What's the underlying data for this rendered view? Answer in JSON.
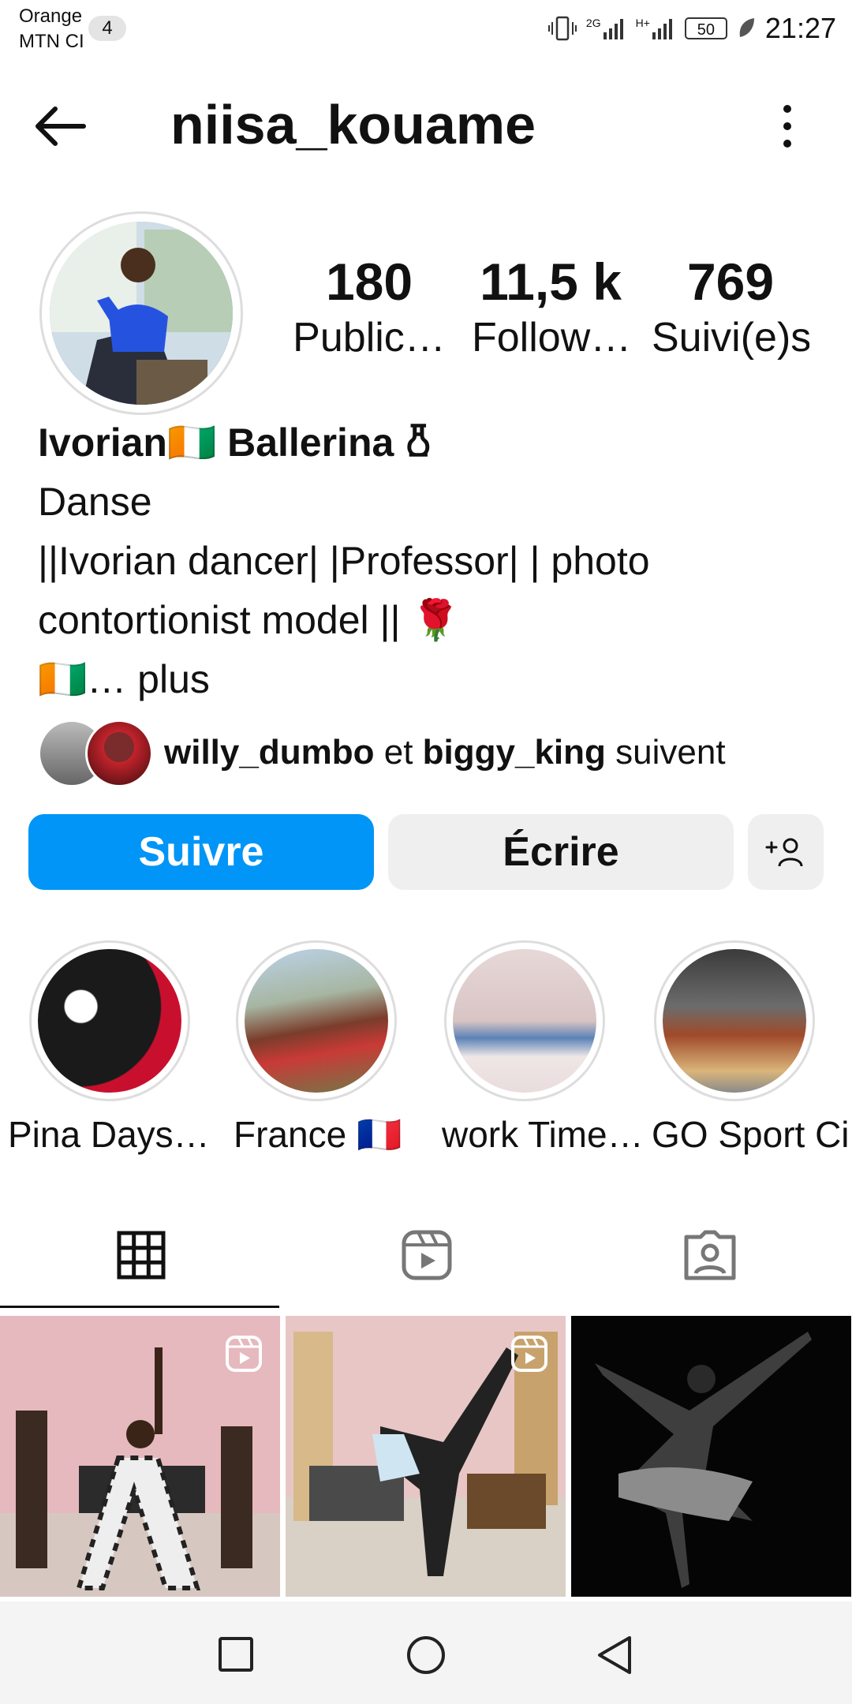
{
  "status_bar": {
    "carrier_line1": "Orange",
    "carrier_line2": "MTN CI",
    "notification_count": "4",
    "network_2g": "2G",
    "network_h": "H+",
    "battery": "50",
    "time": "21:27"
  },
  "header": {
    "username": "niisa_kouame",
    "back_icon": "arrow-left-icon",
    "more_icon": "more-vertical-icon"
  },
  "stats": [
    {
      "value": "180",
      "label": "Public…"
    },
    {
      "value": "11,5 k",
      "label": "Follow…"
    },
    {
      "value": "769",
      "label": "Suivi(e)s"
    }
  ],
  "bio": {
    "display_name": "Ivorian🇨🇮 Ballerina 𐃰",
    "category": "Danse",
    "line1": "||Ivorian dancer| |Professor| | photo",
    "line2": "contortionist model || 🌹",
    "line3": "🇨🇮… plus"
  },
  "mutual": {
    "user1": "willy_dumbo",
    "connector": "et",
    "user2": "biggy_king",
    "suffix": "suivent"
  },
  "actions": {
    "follow_label": "Suivre",
    "message_label": "Écrire",
    "add_user_icon": "add-user-icon",
    "accent_color": "#0095f6"
  },
  "highlights": [
    {
      "label": "Pina Days…"
    },
    {
      "label": "France 🇫🇷"
    },
    {
      "label": "work Time…"
    },
    {
      "label": "GO Sport Ci"
    }
  ],
  "tabs": [
    {
      "icon": "grid-icon",
      "active": true
    },
    {
      "icon": "reels-icon",
      "active": false
    },
    {
      "icon": "tagged-icon",
      "active": false
    }
  ],
  "nav": [
    "recent-apps-icon",
    "home-icon",
    "back-icon"
  ]
}
